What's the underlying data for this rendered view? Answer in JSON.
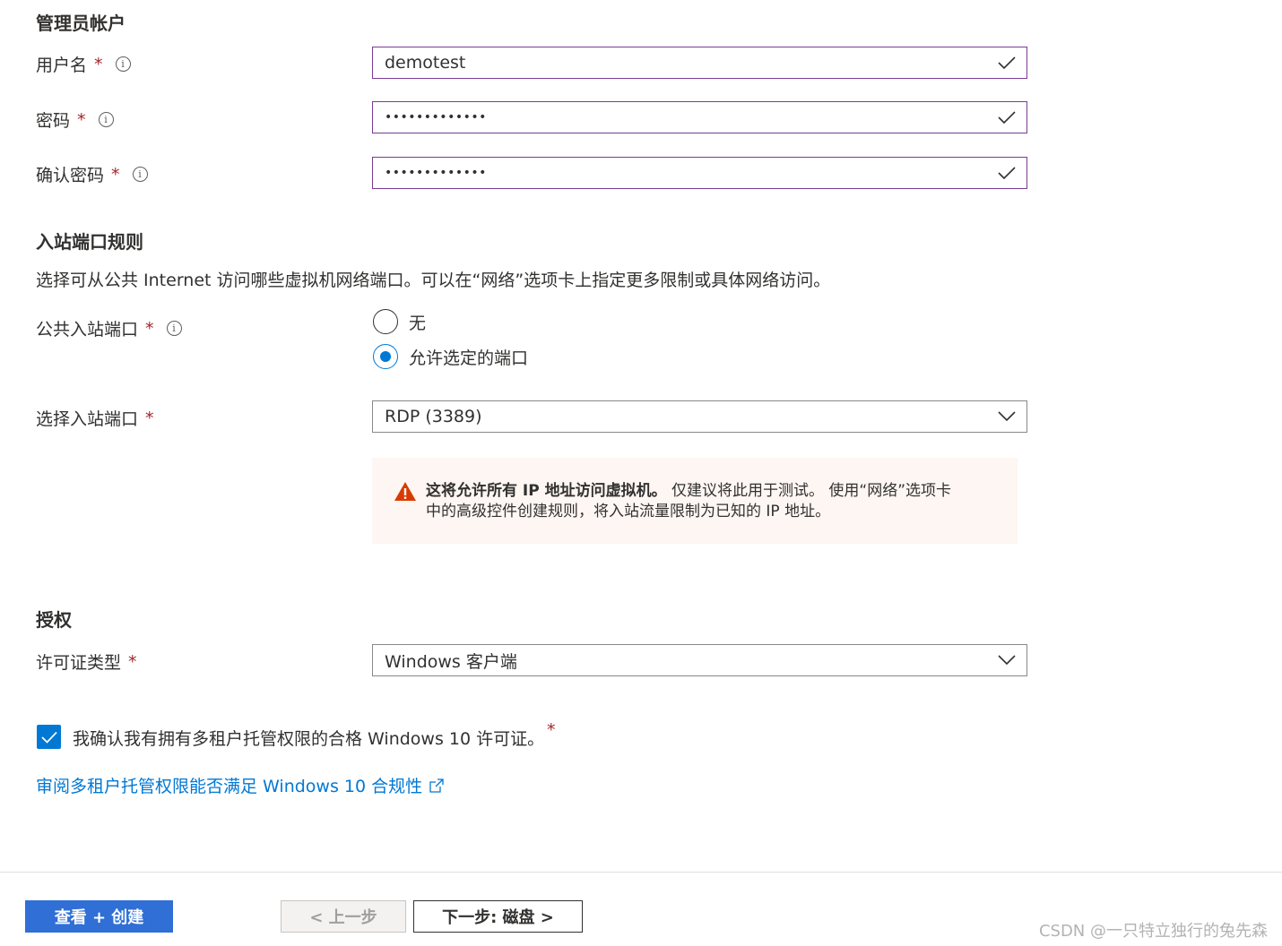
{
  "admin": {
    "section_title": "管理员帐户",
    "username_label": "用户名",
    "username_value": "demotest",
    "password_label": "密码",
    "password_value": "•••••••••••••",
    "confirm_label": "确认密码",
    "confirm_value": "•••••••••••••",
    "required_mark": "*",
    "info_glyph": "i"
  },
  "inbound": {
    "section_title": "入站端口规则",
    "description": "选择可从公共 Internet 访问哪些虚拟机网络端口。可以在“网络”选项卡上指定更多限制或具体网络访问。",
    "public_ports_label": "公共入站端口",
    "radio_none": "无",
    "radio_allow": "允许选定的端口",
    "selected_radio": "允许选定的端口",
    "select_ports_label": "选择入站端口",
    "select_ports_value": "RDP (3389)",
    "warning_bold": "这将允许所有 IP 地址访问虚拟机。",
    "warning_text_1": " 仅建议将此用于测试。 使用“网络”选项卡",
    "warning_text_2": "中的高级控件创建规则，将入站流量限制为已知的 IP 地址。"
  },
  "license": {
    "section_title": "授权",
    "type_label": "许可证类型",
    "type_value": "Windows 客户端",
    "confirm_checkbox_label": "我确认我有拥有多租户托管权限的合格 Windows 10 许可证。",
    "confirm_checked": true,
    "review_link": "审阅多租户托管权限能否满足 Windows 10 合规性"
  },
  "footer": {
    "review_create": "查看 + 创建",
    "previous": "< 上一步",
    "next": "下一步: 磁盘 >"
  },
  "watermark": "CSDN @一只特立独行的兔先森",
  "colors": {
    "accent": "#0078d4",
    "required": "#a4262c",
    "valid_border": "#7a3b94",
    "warning_icon": "#d83b01",
    "warning_bg": "#fdf6f3"
  },
  "icons": [
    "checkmark-icon",
    "info-icon",
    "chevron-down-icon",
    "warning-icon",
    "external-link-icon"
  ]
}
